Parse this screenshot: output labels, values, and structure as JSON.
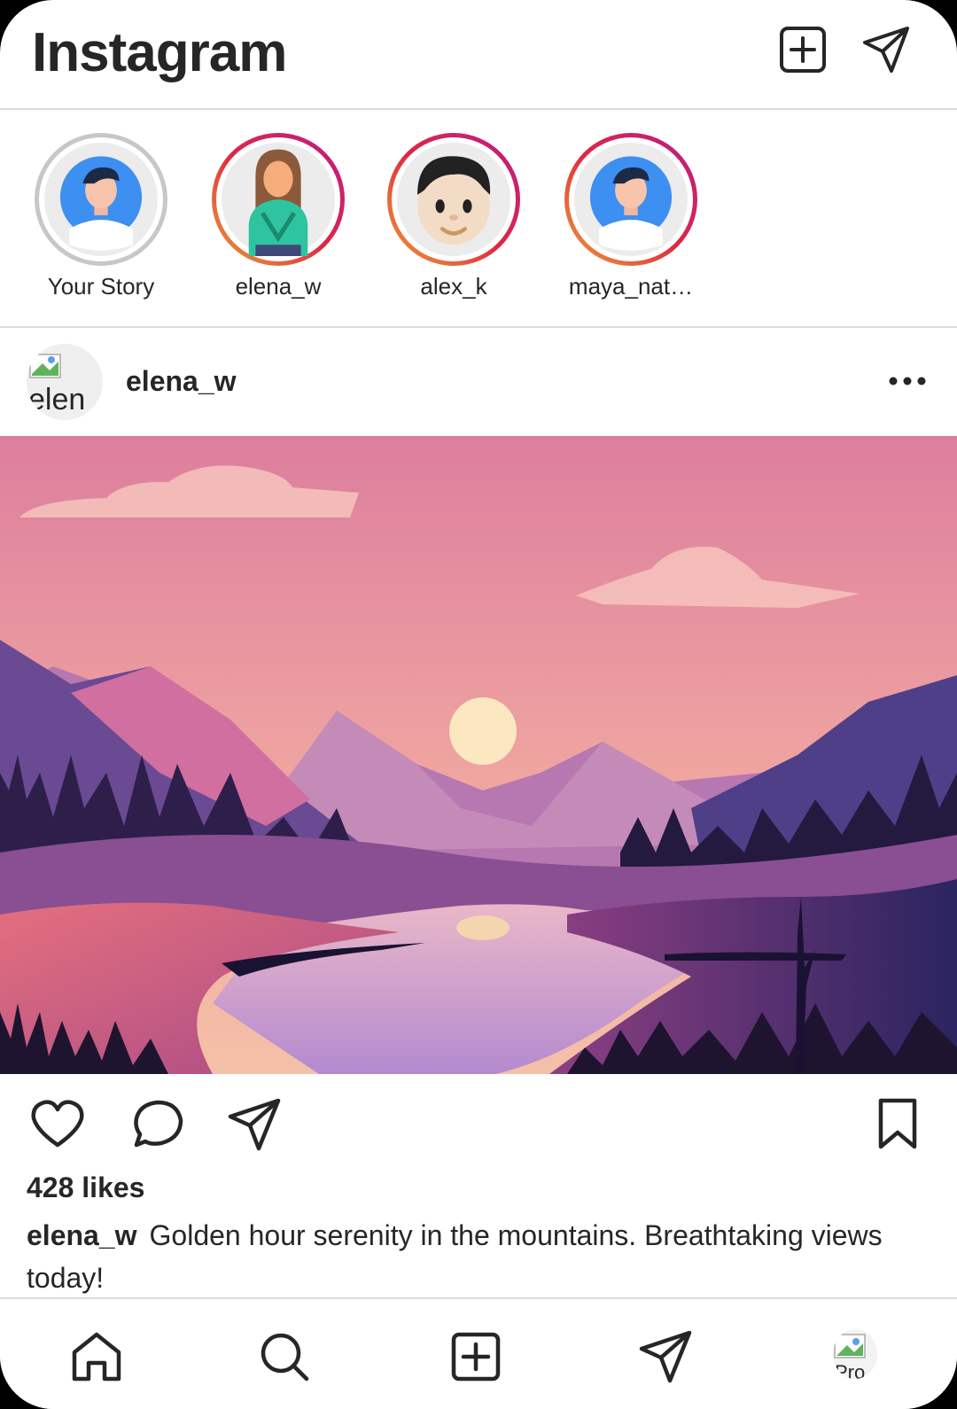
{
  "app": {
    "title": "Instagram"
  },
  "header": {
    "new_post_icon": "plus-square-icon",
    "messages_icon": "paper-plane-icon"
  },
  "stories": [
    {
      "name": "Your Story",
      "seen": true,
      "avatar": "man-blue-bg"
    },
    {
      "name": "elena_w",
      "seen": false,
      "avatar": "woman-green-shirt"
    },
    {
      "name": "alex_k",
      "seen": false,
      "avatar": "boy-face"
    },
    {
      "name": "maya_nat…",
      "seen": false,
      "avatar": "man-blue-bg"
    }
  ],
  "post": {
    "username": "elena_w",
    "avatar_alt": "elen",
    "image_desc": "mountain-lake-sunset-illustration",
    "likes": "428 likes",
    "caption_user": "elena_w",
    "caption_text": "Golden hour serenity in the mountains. Breathtaking views today!"
  },
  "actions": {
    "like": "heart-icon",
    "comment": "comment-bubble-icon",
    "share": "paper-plane-icon",
    "save": "bookmark-icon"
  },
  "bottom_nav": {
    "items": [
      "home-icon",
      "search-icon",
      "plus-square-icon",
      "paper-plane-icon",
      "profile-avatar"
    ],
    "profile_alt": "Pro"
  },
  "colors": {
    "text": "#262626",
    "divider": "#dbdbdb",
    "story_gradient": [
      "#f09433",
      "#bc1888"
    ]
  }
}
